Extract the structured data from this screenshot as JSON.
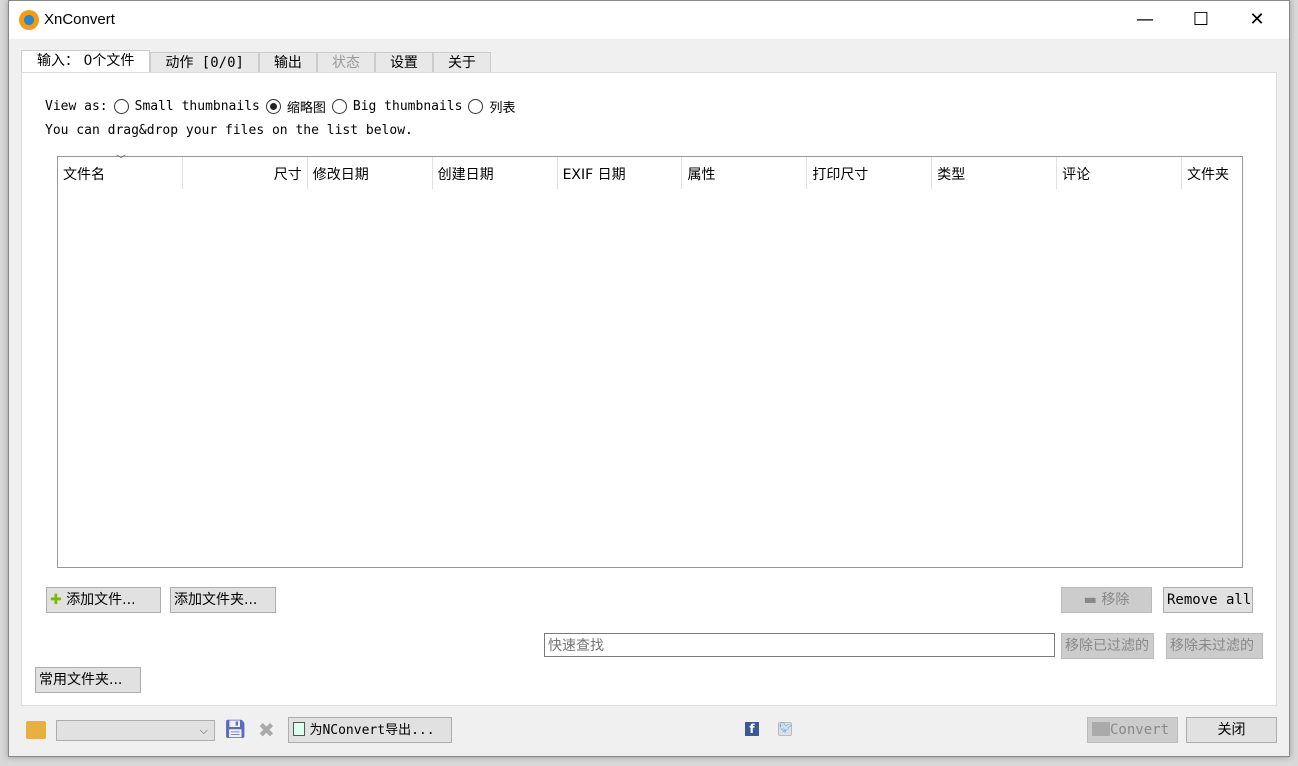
{
  "window": {
    "title": "XnConvert",
    "minimize": "—",
    "maximize": "☐",
    "close": "✕"
  },
  "tabs": [
    {
      "label": "输入： 0个文件",
      "state": "active"
    },
    {
      "label": "动作 [0/0]"
    },
    {
      "label": "输出"
    },
    {
      "label": "状态",
      "state": "disabled"
    },
    {
      "label": "设置"
    },
    {
      "label": "关于"
    }
  ],
  "view": {
    "label": "View as:",
    "options": [
      {
        "label": "Small thumbnails",
        "selected": false
      },
      {
        "label": "缩略图",
        "selected": true
      },
      {
        "label": "Big thumbnails",
        "selected": false
      },
      {
        "label": "列表",
        "selected": false
      }
    ],
    "hint": "You can drag&drop your files on the list below."
  },
  "columns": [
    "文件名",
    "尺寸",
    "修改日期",
    "创建日期",
    "EXIF 日期",
    "属性",
    "打印尺寸",
    "类型",
    "评论",
    "文件夹"
  ],
  "buttons": {
    "add_files": "添加文件...",
    "add_folder": "添加文件夹...",
    "remove": "移除",
    "remove_all": "Remove all",
    "remove_filtered": "移除已过滤的",
    "remove_unfiltered": "移除未过滤的",
    "favorites": "常用文件夹...",
    "export": "为NConvert导出...",
    "convert": "Convert",
    "close": "关闭"
  },
  "search": {
    "placeholder": "快速查找",
    "value": ""
  },
  "preset": {
    "value": ""
  }
}
